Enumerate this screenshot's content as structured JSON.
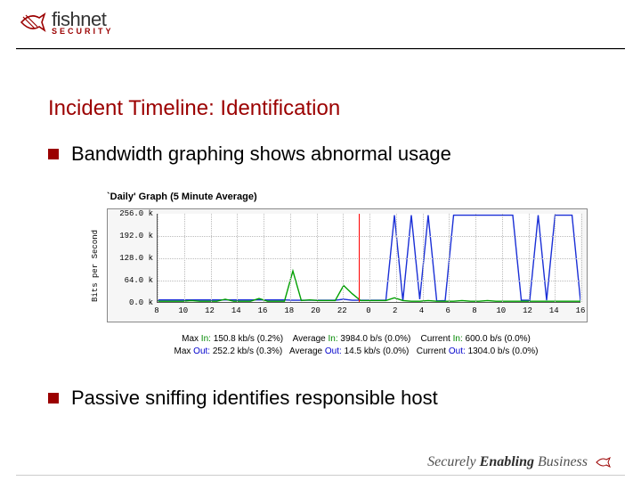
{
  "logo": {
    "main": "fishnet",
    "sub": "SECURITY"
  },
  "title": "Incident Timeline: Identification",
  "bullets": [
    "Bandwidth graphing shows abnormal usage",
    "Passive sniffing identifies responsible host"
  ],
  "chart_data": {
    "type": "line",
    "title": "`Daily' Graph (5 Minute Average)",
    "xlabel": "",
    "ylabel": "Bits per Second",
    "ylim": [
      0,
      256
    ],
    "yticks": [
      "256.0 k",
      "192.0 k",
      "128.0 k",
      "64.0 k",
      "0.0 k"
    ],
    "xticks": [
      "8",
      "10",
      "12",
      "14",
      "16",
      "18",
      "20",
      "22",
      "0",
      "2",
      "4",
      "6",
      "8",
      "10",
      "12",
      "14",
      "16"
    ],
    "marker_x": 7.6,
    "series": [
      {
        "name": "Out",
        "color": "#1a2fd6",
        "values": [
          6,
          6,
          6,
          6,
          6,
          6,
          6,
          6,
          6,
          6,
          6,
          6,
          6,
          6,
          6,
          6,
          5,
          5,
          5,
          5,
          5,
          5,
          8,
          5,
          5,
          5,
          5,
          5,
          252,
          3,
          252,
          8,
          252,
          3,
          4,
          252,
          252,
          252,
          252,
          252,
          252,
          252,
          252,
          5,
          5,
          252,
          5,
          252,
          252,
          252,
          4
        ]
      },
      {
        "name": "In",
        "color": "#00a000",
        "values": [
          2,
          2,
          2,
          2,
          4,
          2,
          2,
          2,
          8,
          2,
          2,
          2,
          10,
          2,
          2,
          2,
          90,
          4,
          6,
          4,
          4,
          4,
          48,
          24,
          4,
          4,
          4,
          4,
          12,
          4,
          2,
          2,
          4,
          2,
          2,
          2,
          4,
          2,
          2,
          4,
          2,
          2,
          2,
          2,
          2,
          2,
          2,
          2,
          2,
          2,
          2
        ]
      }
    ]
  },
  "stats": {
    "row1": {
      "max_label": "Max",
      "avg_label": "Average",
      "cur_label": "Current",
      "in_label": "In:",
      "max": "150.8 kb/s (0.2%)",
      "avg": "3984.0 b/s (0.0%)",
      "cur": " 600.0 b/s (0.0%)"
    },
    "row2": {
      "max_label": "Max",
      "avg_label": "Average",
      "cur_label": "Current",
      "out_label": "Out:",
      "max": "252.2 kb/s (0.3%)",
      "avg": " 14.5 kb/s (0.0%)",
      "cur": "1304.0 b/s (0.0%)"
    }
  },
  "footer": {
    "pre": "Securely ",
    "mid": "Enabling",
    "post": " Business"
  }
}
